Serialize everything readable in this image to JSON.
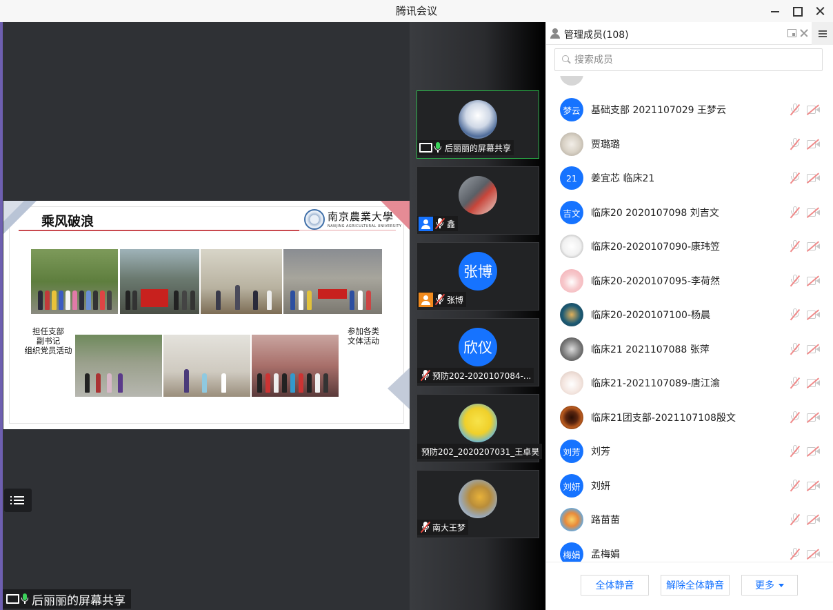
{
  "window": {
    "title": "腾讯会议"
  },
  "share": {
    "label": "后丽丽的屏幕共享",
    "slide": {
      "title": "乘风破浪",
      "university_cn": "南京農業大學",
      "university_en": "NANJING AGRICULTURAL UNIVERSITY",
      "caption_left": [
        "担任支部",
        "副书记",
        "组织党员活动"
      ],
      "caption_right": [
        "参加各类",
        "文体活动"
      ]
    }
  },
  "tiles": [
    {
      "name": "后丽丽的屏幕共享",
      "avatar_text": "",
      "mic": "on",
      "sharing": true,
      "active": true
    },
    {
      "name": "鑫",
      "avatar_text": "",
      "mic": "muted",
      "user_icon": "blue"
    },
    {
      "name": "张博",
      "avatar_text": "张博",
      "mic": "muted",
      "user_icon": "orange"
    },
    {
      "name": "预防202-2020107084-...",
      "avatar_text": "欣仪",
      "mic": "muted"
    },
    {
      "name": "预防202_2020207031_王卓昊",
      "avatar_text": "",
      "mic": "none"
    },
    {
      "name": "南大王梦",
      "avatar_text": "",
      "mic": "muted"
    }
  ],
  "panel": {
    "title": "管理成员(108)",
    "search_placeholder": "搜索成员",
    "members": [
      {
        "name": "基础支部 2021107029 王梦云",
        "avatar_text": "梦云"
      },
      {
        "name": "贾璐璐",
        "avatar_text": ""
      },
      {
        "name": "姜宜芯 临床21",
        "avatar_text": "21"
      },
      {
        "name": "临床20 2020107098 刘吉文",
        "avatar_text": "吉文"
      },
      {
        "name": "临床20-2020107090-康玮笠",
        "avatar_text": ""
      },
      {
        "name": "临床20-2020107095-李荷然",
        "avatar_text": ""
      },
      {
        "name": "临床20-2020107100-杨晨",
        "avatar_text": ""
      },
      {
        "name": "临床21 2021107088 张萍",
        "avatar_text": ""
      },
      {
        "name": "临床21-2021107089-唐江渝",
        "avatar_text": ""
      },
      {
        "name": "临床21团支部-2021107108殷文",
        "avatar_text": ""
      },
      {
        "name": "刘芳",
        "avatar_text": "刘芳"
      },
      {
        "name": "刘妍",
        "avatar_text": "刘妍"
      },
      {
        "name": "路苗苗",
        "avatar_text": ""
      },
      {
        "name": "孟梅娟",
        "avatar_text": "梅娟"
      }
    ],
    "footer": {
      "mute_all": "全体静音",
      "unmute_all": "解除全体静音",
      "more": "更多"
    }
  },
  "colors": {
    "accent": "#1673ff",
    "active_border": "#2bb54a",
    "mute_red": "#e8483f"
  }
}
